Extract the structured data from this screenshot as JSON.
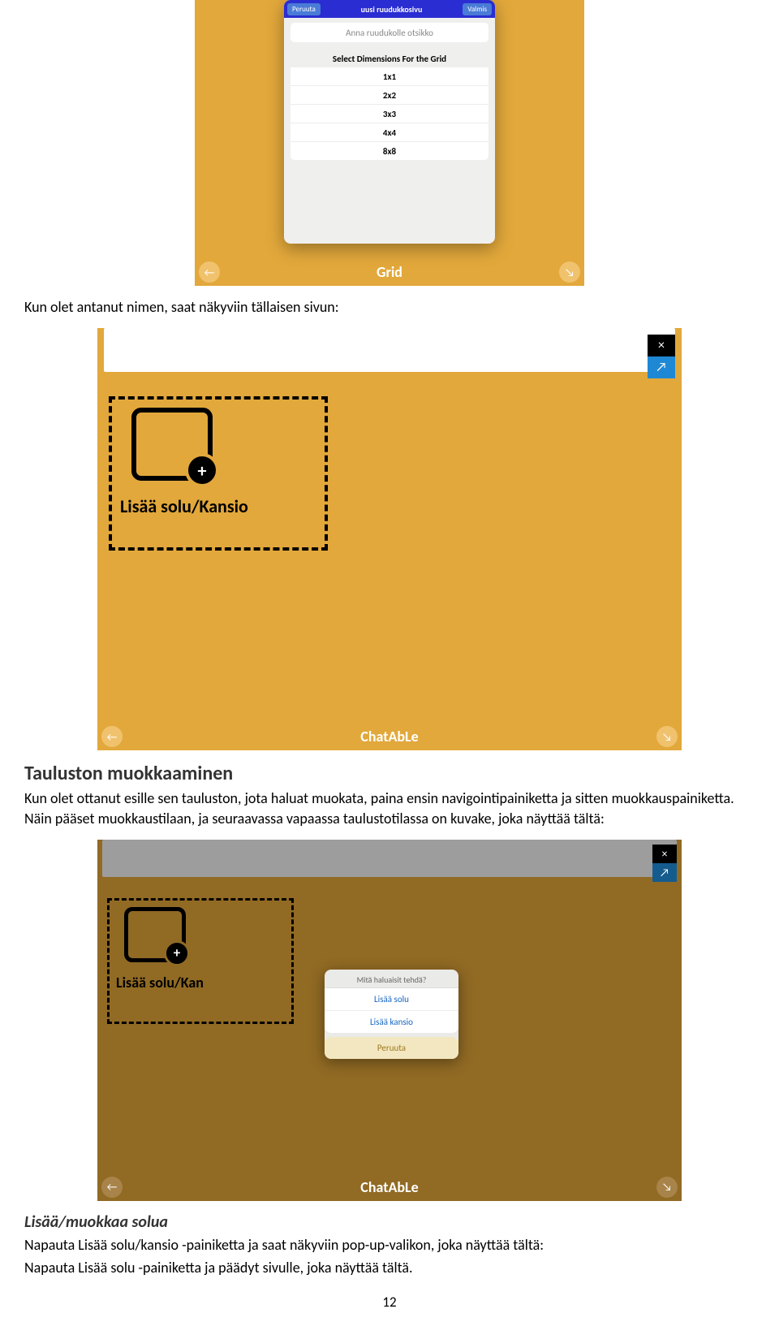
{
  "screenshot1": {
    "cancel": "Peruuta",
    "title": "uusi ruudukkosivu",
    "done": "Valmis",
    "input_placeholder": "Anna ruudukolle otsikko",
    "section_title": "Select Dimensions For the Grid",
    "options": [
      "1x1",
      "2x2",
      "3x3",
      "4x4",
      "8x8"
    ],
    "bottom_title": "Grid",
    "nav_left": "←",
    "nav_right": "↘"
  },
  "paragraph1": "Kun olet antanut nimen, saat näkyviin tällaisen sivun:",
  "screenshot2": {
    "close": "×",
    "share": "↗",
    "cell_label": "Lisää solu/Kansio",
    "bottom_title": "ChatAbLe",
    "nav_left": "←",
    "nav_right": "↘"
  },
  "heading2": "Tauluston muokkaaminen",
  "paragraph2": "Kun olet ottanut esille sen tauluston, jota haluat muokata, paina ensin navigointipainiketta ja sitten muokkauspainiketta. Näin pääset muokkaustilaan, ja seuraavassa vapaassa taulustotilassa on kuvake, joka näyttää tältä:",
  "screenshot3": {
    "close": "×",
    "share": "↗",
    "cell_label": "Lisää solu/Kan",
    "popup_title": "Mitä haluaisit tehdä?",
    "popup_opt1": "Lisää solu",
    "popup_opt2": "Lisää kansio",
    "popup_cancel": "Peruuta",
    "bottom_title": "ChatAbLe",
    "nav_left": "←",
    "nav_right": "↘"
  },
  "heading3": "Lisää/muokkaa solua",
  "paragraph3a": "Napauta Lisää solu/kansio -painiketta ja saat näkyviin pop-up-valikon, joka näyttää tältä:",
  "paragraph3b": "Napauta Lisää solu -painiketta ja päädyt sivulle, joka näyttää tältä.",
  "page_number": "12"
}
